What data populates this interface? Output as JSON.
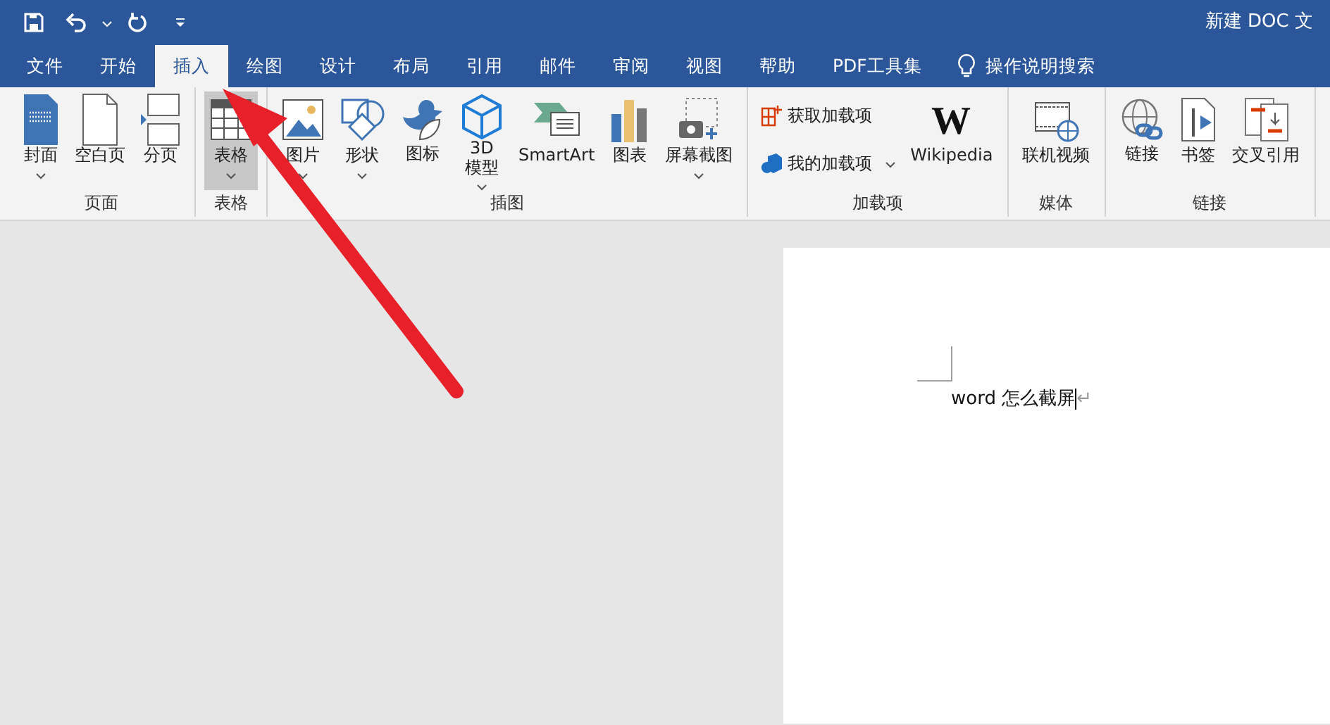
{
  "window": {
    "title": "新建 DOC 文"
  },
  "quick_access": {
    "undo_dropdown": true
  },
  "tabs": [
    {
      "label": "文件",
      "selected": false
    },
    {
      "label": "开始",
      "selected": false
    },
    {
      "label": "插入",
      "selected": true
    },
    {
      "label": "绘图",
      "selected": false
    },
    {
      "label": "设计",
      "selected": false
    },
    {
      "label": "布局",
      "selected": false
    },
    {
      "label": "引用",
      "selected": false
    },
    {
      "label": "邮件",
      "selected": false
    },
    {
      "label": "审阅",
      "selected": false
    },
    {
      "label": "视图",
      "selected": false
    },
    {
      "label": "帮助",
      "selected": false
    },
    {
      "label": "PDF工具集",
      "selected": false
    }
  ],
  "tell_me": {
    "placeholder": "操作说明搜索"
  },
  "ribbon_groups": [
    {
      "label": "页面",
      "items": [
        {
          "kind": "large",
          "label": "封面",
          "dropdown": true,
          "selected": false,
          "wrap": false
        },
        {
          "kind": "large",
          "label": "空白页",
          "dropdown": false,
          "selected": false,
          "wrap": false
        },
        {
          "kind": "large",
          "label": "分页",
          "dropdown": false,
          "selected": false,
          "wrap": false
        }
      ]
    },
    {
      "label": "表格",
      "items": [
        {
          "kind": "large",
          "label": "表格",
          "dropdown": true,
          "selected": true,
          "wrap": false
        }
      ]
    },
    {
      "label": "插图",
      "items": [
        {
          "kind": "large",
          "label": "图片",
          "dropdown": true,
          "selected": false,
          "wrap": false
        },
        {
          "kind": "large",
          "label": "形状",
          "dropdown": true,
          "selected": false,
          "wrap": false
        },
        {
          "kind": "large",
          "label": "图标",
          "dropdown": false,
          "selected": false,
          "wrap": true
        },
        {
          "kind": "large",
          "label": "3D 模型",
          "dropdown": true,
          "selected": false,
          "wrap": true
        },
        {
          "kind": "large",
          "label": "SmartArt",
          "dropdown": false,
          "selected": false,
          "wrap": false
        },
        {
          "kind": "large",
          "label": "图表",
          "dropdown": false,
          "selected": false,
          "wrap": false
        },
        {
          "kind": "large",
          "label": "屏幕截图",
          "dropdown": true,
          "selected": false,
          "wrap": false
        }
      ]
    },
    {
      "label": "加载项",
      "items": [
        {
          "kind": "small",
          "label": "获取加载项",
          "dropdown": false
        },
        {
          "kind": "small",
          "label": "我的加载项",
          "dropdown": true
        },
        {
          "kind": "large",
          "label": "Wikipedia",
          "logo": "W",
          "dropdown": false,
          "selected": false,
          "wrap": false
        }
      ]
    },
    {
      "label": "媒体",
      "items": [
        {
          "kind": "large",
          "label": "联机视频",
          "dropdown": false,
          "selected": false,
          "wrap": false
        }
      ]
    },
    {
      "label": "链接",
      "items": [
        {
          "kind": "large",
          "label": "链接",
          "dropdown": false,
          "selected": false,
          "wrap": true
        },
        {
          "kind": "large",
          "label": "书签",
          "dropdown": false,
          "selected": false,
          "wrap": false
        },
        {
          "kind": "large",
          "label": "交叉引用",
          "dropdown": false,
          "selected": false,
          "wrap": false
        }
      ]
    }
  ],
  "document": {
    "text": "word 怎么截屏",
    "paragraph_mark": "↵"
  }
}
